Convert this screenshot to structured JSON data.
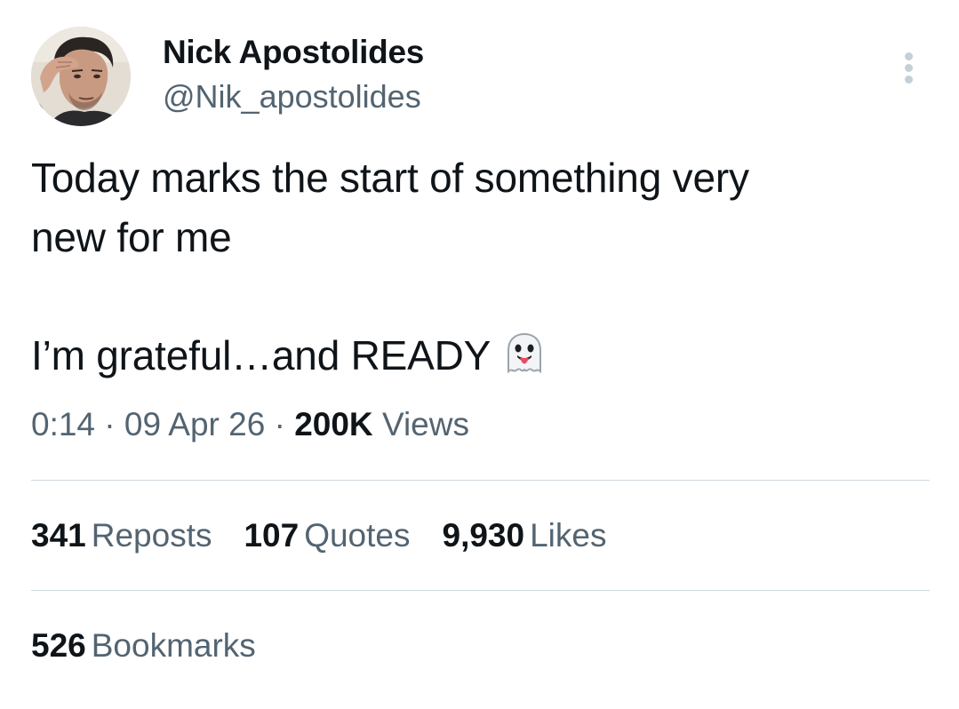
{
  "author": {
    "display_name": "Nick Apostolides",
    "handle": "@Nik_apostolides"
  },
  "post": {
    "line1": "Today marks the start of something very",
    "line2": "new for me",
    "line3": "I’m grateful…and READY",
    "emoji": "ghost-emoji"
  },
  "meta": {
    "time": "0:14",
    "separator": "·",
    "date": "09 Apr 26",
    "views_count": "200K",
    "views_label": "Views"
  },
  "stats": {
    "reposts": {
      "count": "341",
      "label": "Reposts"
    },
    "quotes": {
      "count": "107",
      "label": "Quotes"
    },
    "likes": {
      "count": "9,930",
      "label": "Likes"
    },
    "bookmarks": {
      "count": "526",
      "label": "Bookmarks"
    }
  },
  "icons": {
    "more": "more-options-icon"
  },
  "colors": {
    "text_primary": "#0f1419",
    "text_secondary": "#536471",
    "divider": "#cfd9de"
  }
}
